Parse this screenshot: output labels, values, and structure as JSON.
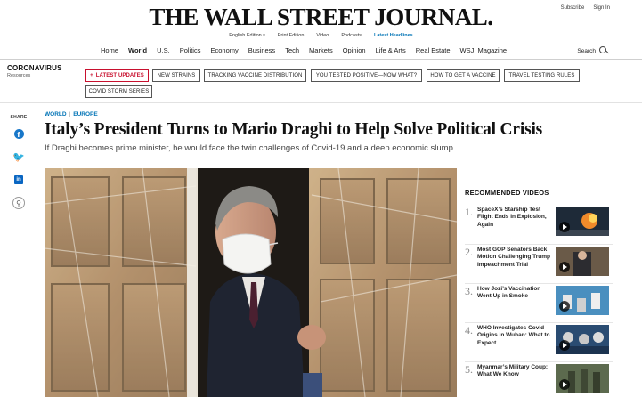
{
  "header": {
    "masthead": "THE WALL STREET JOURNAL.",
    "subscribe": "Subscribe",
    "signin": "Sign In",
    "subnav": {
      "edition": "English Edition",
      "print": "Print Edition",
      "video": "Video",
      "podcasts": "Podcasts",
      "latest": "Latest Headlines"
    }
  },
  "nav": {
    "items": [
      "Home",
      "World",
      "U.S.",
      "Politics",
      "Economy",
      "Business",
      "Tech",
      "Markets",
      "Opinion",
      "Life & Arts",
      "Real Estate",
      "WSJ. Magazine"
    ],
    "active": "World",
    "search_label": "Search"
  },
  "covid_bar": {
    "title": "CORONAVIRUS",
    "subtitle": "Resources",
    "pills": [
      "LATEST UPDATES",
      "NEW STRAINS",
      "TRACKING VACCINE DISTRIBUTION",
      "YOU TESTED POSITIVE—NOW WHAT?",
      "HOW TO GET A VACCINE",
      "TRAVEL TESTING RULES",
      "COVID STORM SERIES"
    ],
    "plus": "+"
  },
  "share": {
    "label": "SHARE",
    "icons": [
      "facebook-icon",
      "twitter-icon",
      "linkedin-icon",
      "link-icon"
    ],
    "fb_glyph": "f",
    "tw_glyph": "🐦",
    "li_glyph": "in",
    "link_glyph": "🔗"
  },
  "article": {
    "section": "WORLD",
    "subsection": "EUROPE",
    "separator": "|",
    "headline": "Italy’s President Turns to Mario Draghi to Help Solve Political Crisis",
    "dek": "If Draghi becomes prime minister, he would face the twin challenges of Covid-19 and a deep economic slump"
  },
  "recommended": {
    "title": "RECOMMENDED VIDEOS",
    "items": [
      {
        "num": "1.",
        "title": "SpaceX’s Starship Test Flight Ends in Explosion, Again"
      },
      {
        "num": "2.",
        "title": "Most GOP Senators Back Motion Challenging Trump Impeachment Trial"
      },
      {
        "num": "3.",
        "title": "How Jozi’s Vaccination Went Up in Smoke"
      },
      {
        "num": "4.",
        "title": "WHO Investigates Covid Origins in Wuhan: What to Expect"
      },
      {
        "num": "5.",
        "title": "Myanmar’s Military Coup: What We Know"
      }
    ]
  },
  "colors": {
    "accent_blue": "#0274b6",
    "alert_red": "#c8102e"
  }
}
